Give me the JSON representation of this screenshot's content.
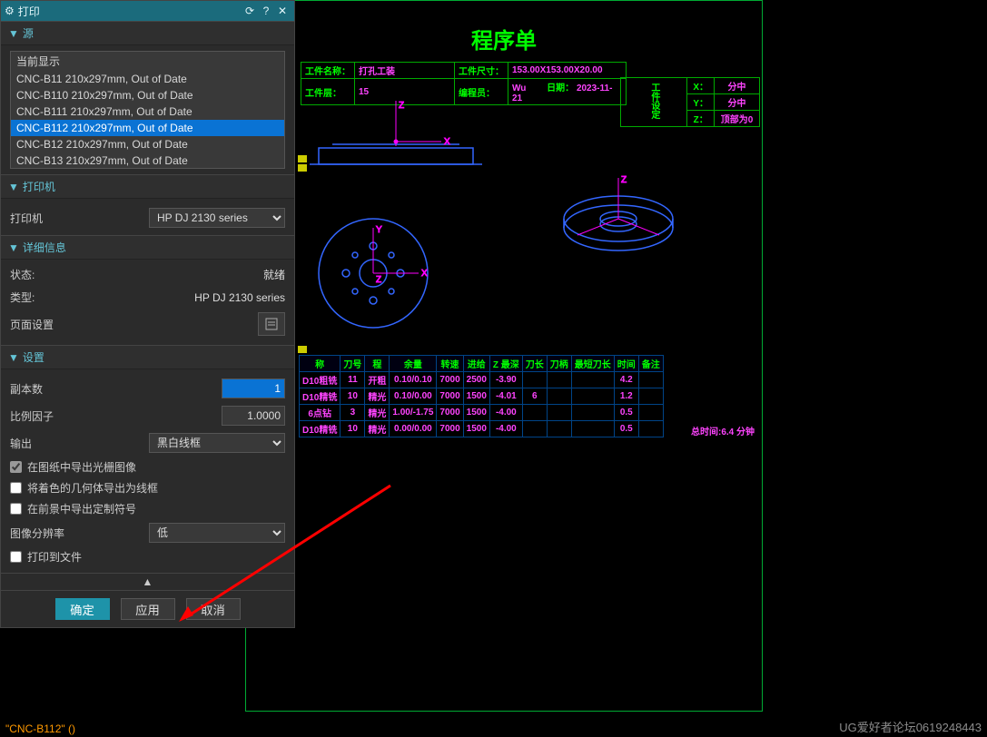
{
  "dialog": {
    "title": "打印",
    "icons": {
      "gear": "⚙",
      "refresh": "⟳",
      "help": "?",
      "close": "✕"
    },
    "source": {
      "header": "源",
      "items": [
        "当前显示",
        "CNC-B11   210x297mm, Out of Date",
        "CNC-B110  210x297mm, Out of Date",
        "CNC-B111  210x297mm, Out of Date",
        "CNC-B112  210x297mm, Out of Date",
        "CNC-B12   210x297mm, Out of Date",
        "CNC-B13   210x297mm, Out of Date"
      ],
      "selected_index": 4
    },
    "printer": {
      "header": "打印机",
      "label": "打印机",
      "value": "HP DJ 2130 series",
      "detail_header": "详细信息",
      "state_label": "状态:",
      "state_value": "就绪",
      "type_label": "类型:",
      "type_value": "HP DJ 2130 series",
      "pageset_label": "页面设置"
    },
    "settings": {
      "header": "设置",
      "copies_label": "副本数",
      "copies_value": "1",
      "scale_label": "比例因子",
      "scale_value": "1.0000",
      "output_label": "输出",
      "output_value": "黑白线框",
      "chk1": "在图纸中导出光栅图像",
      "chk2": "将着色的几何体导出为线框",
      "chk3": "在前景中导出定制符号",
      "res_label": "图像分辨率",
      "res_value": "低",
      "chk4": "打印到文件"
    },
    "footer": {
      "ok": "确定",
      "apply": "应用",
      "cancel": "取消",
      "collapse": "▲"
    }
  },
  "sheet": {
    "title": "程序单",
    "info": {
      "name_lbl": "工件名称：",
      "name_val": "打孔工装",
      "size_lbl": "工件尺寸：",
      "size_val": "153.00X153.00X20.00",
      "layer_lbl": "工件层：",
      "layer_val": "15",
      "prog_lbl": "编程员：",
      "prog_val": "Wu",
      "date_lbl": "日期：",
      "date_val": "2023-11-21"
    },
    "side": {
      "group": "工件设定",
      "x_lbl": "X：",
      "x_val": "分中",
      "y_lbl": "Y：",
      "y_val": "分中",
      "z_lbl": "Z：",
      "z_val": "顶部为0"
    },
    "table_headers": [
      "称",
      "刀号",
      "程",
      "余量",
      "转速",
      "进给",
      "Z 最深",
      "刀长",
      "刀柄",
      "最短刀长",
      "时间",
      "备注"
    ],
    "rows": [
      [
        "D10粗铣",
        "11",
        "开粗",
        "0.10/0.10",
        "7000",
        "2500",
        "-3.90",
        "",
        "",
        "",
        "4.2",
        ""
      ],
      [
        "D10精铣",
        "10",
        "精光",
        "0.10/0.00",
        "7000",
        "1500",
        "-4.01",
        "6",
        "",
        "",
        "1.2",
        ""
      ],
      [
        "6点钻",
        "3",
        "精光",
        "1.00/-1.75",
        "7000",
        "1500",
        "-4.00",
        "",
        "",
        "",
        "0.5",
        ""
      ],
      [
        "D10精铣",
        "10",
        "精光",
        "0.00/0.00",
        "7000",
        "1500",
        "-4.00",
        "",
        "",
        "",
        "0.5",
        ""
      ]
    ],
    "total_time": "总时间:6.4 分钟"
  },
  "status": "\"CNC-B112\" ()",
  "watermark": "UG爱好者论坛0619248443"
}
